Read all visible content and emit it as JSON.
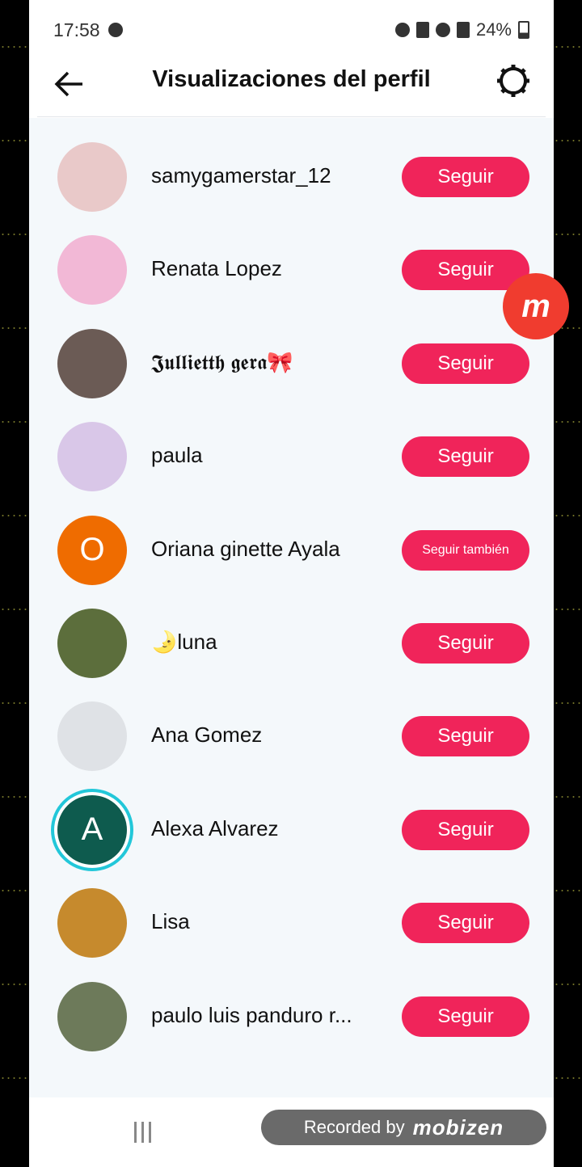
{
  "status_bar": {
    "time": "17:58",
    "battery": "24%"
  },
  "header": {
    "title": "Visualizaciones del perfil"
  },
  "profiles": [
    {
      "name": "samygamerstar_12",
      "button": "Seguir",
      "avatar_color": "#e9c9c9"
    },
    {
      "name": "Renata Lopez",
      "button": "Seguir",
      "avatar_color": "#f2b8d6"
    },
    {
      "name": "𝕵𝖚𝖑𝖑𝖎𝖊𝖙𝖙𝖍 𝖌𝖊𝖗𝖆🎀",
      "button": "Seguir",
      "avatar_color": "#6b5b55"
    },
    {
      "name": "paula",
      "button": "Seguir",
      "avatar_color": "#d9c7e8"
    },
    {
      "name": "Oriana ginette Ayala",
      "button": "Seguir también",
      "avatar_letter": "O",
      "avatar_color": "#ef6c00"
    },
    {
      "name": "🌛luna",
      "button": "Seguir",
      "avatar_color": "#5c6e3c"
    },
    {
      "name": "Ana Gomez",
      "button": "Seguir",
      "avatar_color": "#dfe2e6"
    },
    {
      "name": "Alexa Alvarez",
      "button": "Seguir",
      "avatar_letter": "A",
      "avatar_color": "#0e5b4e"
    },
    {
      "name": "Lisa",
      "button": "Seguir",
      "avatar_color": "#c68a2d"
    },
    {
      "name": "paulo luis panduro r...",
      "button": "Seguir",
      "avatar_color": "#6d7a5a"
    }
  ],
  "overlay": {
    "recorded_by": "Recorded by",
    "brand": "mobizen"
  },
  "colors": {
    "accent": "#f0245a"
  }
}
